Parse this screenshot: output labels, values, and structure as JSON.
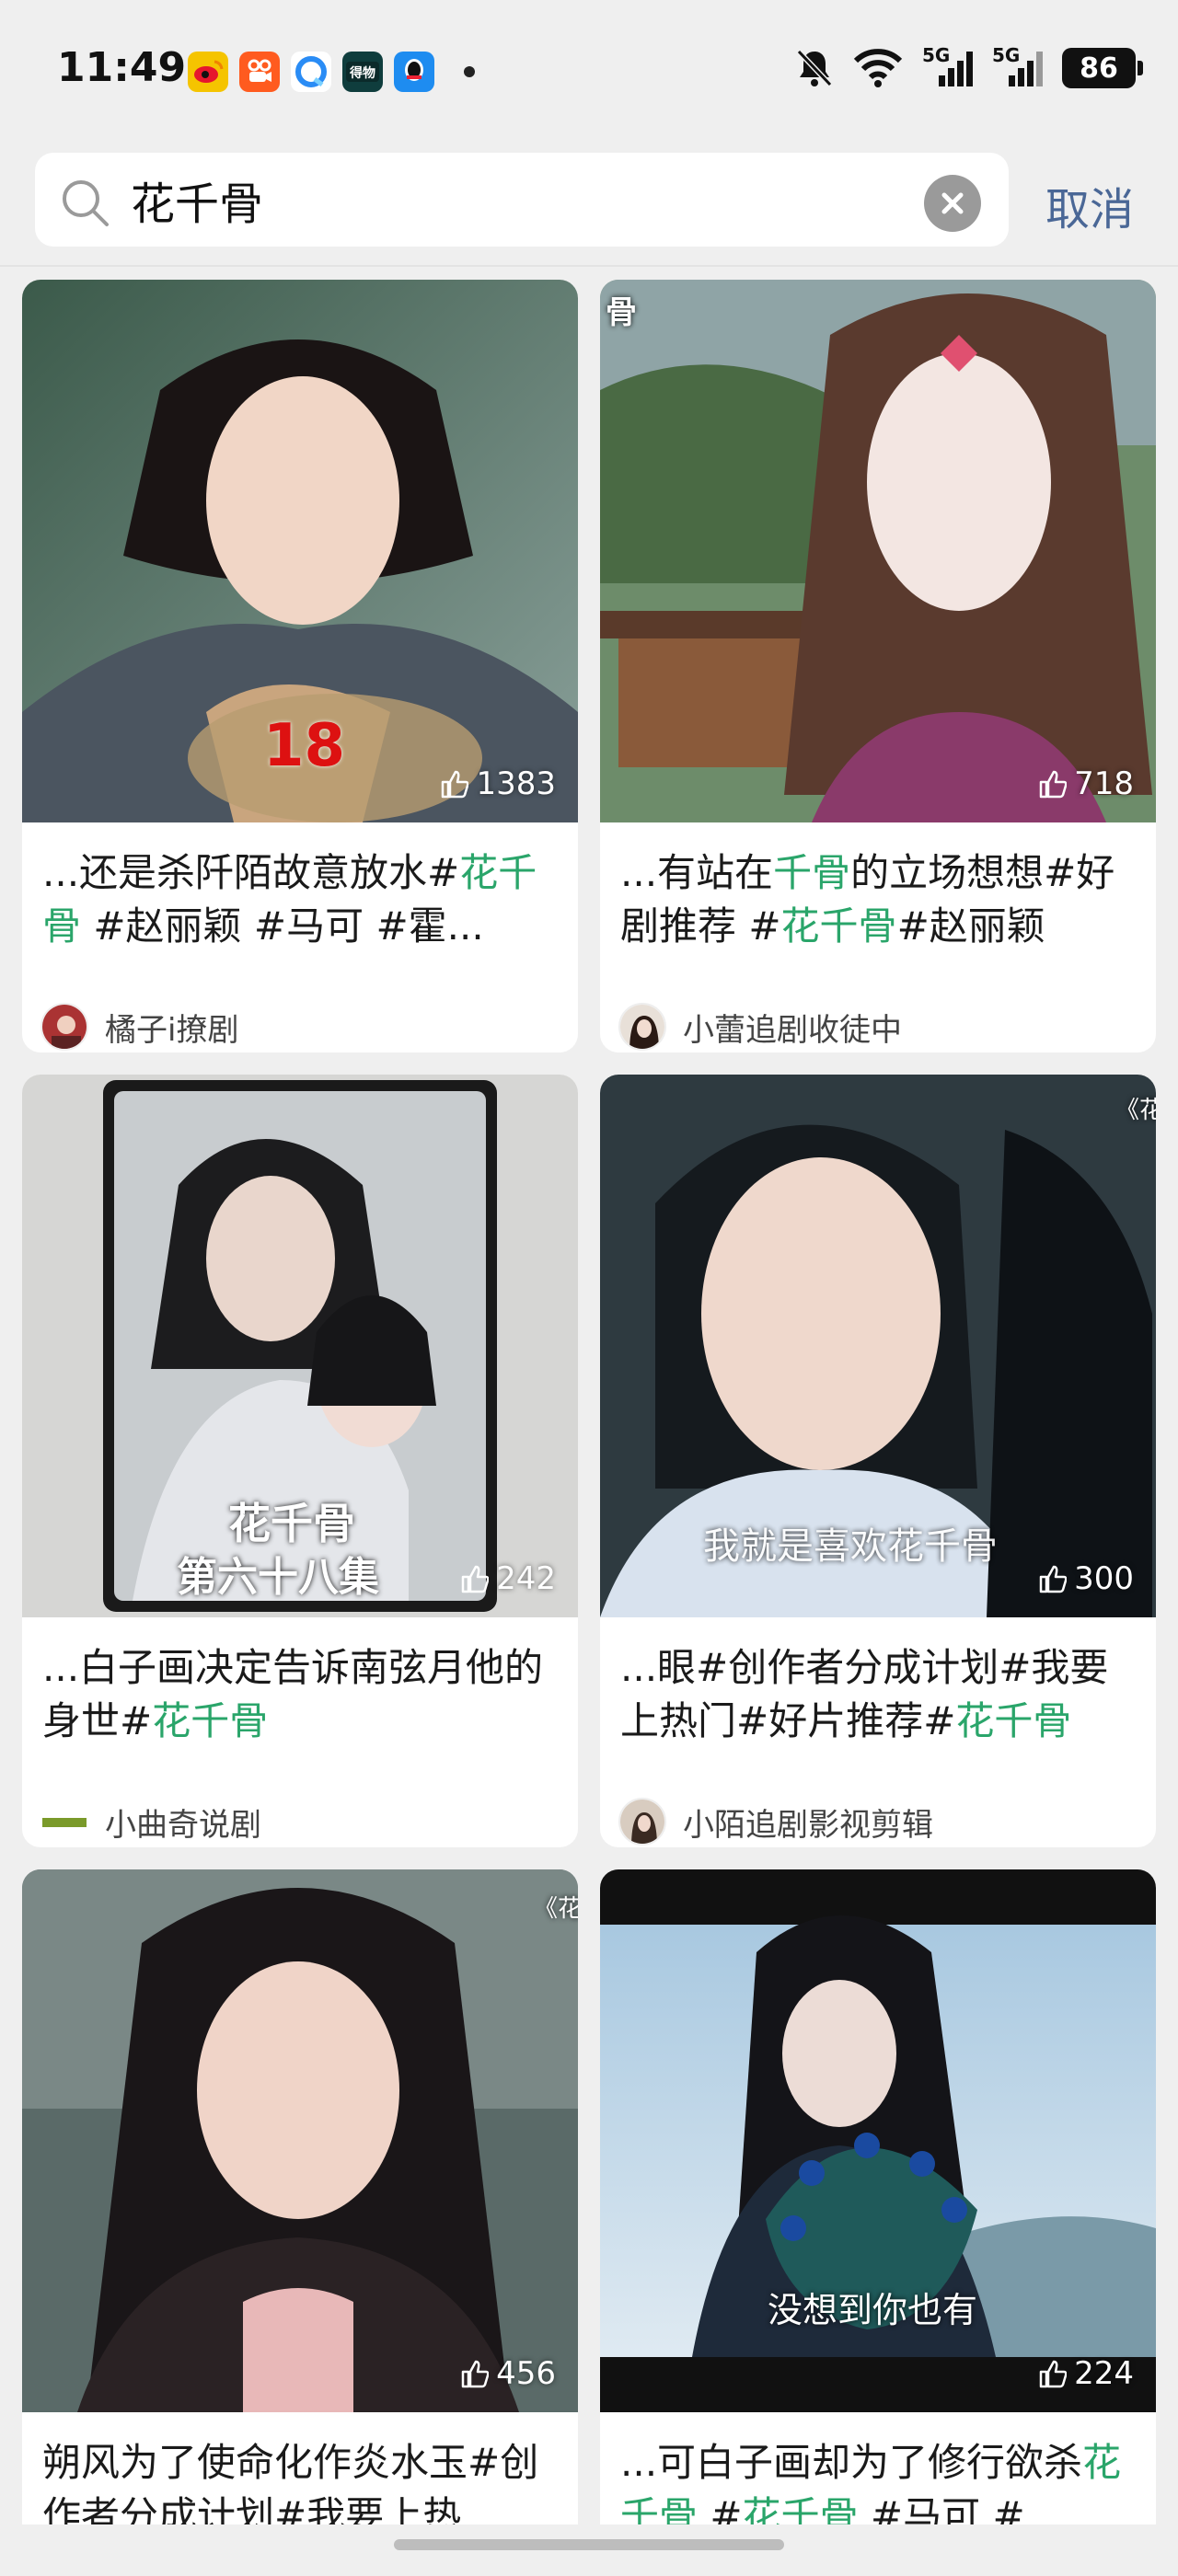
{
  "status_bar": {
    "time": "11:49",
    "battery": "86",
    "signal_1": "5G",
    "signal_2": "5G",
    "app_icons": [
      "weibo-icon",
      "kuaishou-icon",
      "browser-icon",
      "dewu-icon",
      "qq-icon"
    ],
    "system_icons": [
      "mute-icon",
      "wifi-icon",
      "signal-5g-icon",
      "signal-5g-icon",
      "battery-icon"
    ]
  },
  "search": {
    "query": "花千骨",
    "cancel_label": "取消"
  },
  "colors": {
    "highlight": "#2aa56a",
    "cancel": "#4a6796"
  },
  "cards": [
    {
      "likes": "1383",
      "caption_parts": [
        "...还是杀阡陌故意放水#",
        "花千骨",
        " #赵丽颖 #马可 #霍..."
      ],
      "author": "橘子i撩剧",
      "overlay": "18"
    },
    {
      "likes": "718",
      "caption_parts": [
        "...有站在",
        "千骨",
        "的立场想想#好剧推荐 #",
        "花千骨",
        "#赵丽颖"
      ],
      "author": "小蕾追剧收徒中",
      "overlay": "骨"
    },
    {
      "likes": "242",
      "caption_parts": [
        "...白子画决定告诉南弦月他的身世#",
        "花千骨"
      ],
      "author": "小曲奇说剧",
      "overlay": "花千骨",
      "overlay2": "第六十八集"
    },
    {
      "likes": "300",
      "caption_parts": [
        "...眼#创作者分成计划#我要上热门#好片推荐#",
        "花千骨"
      ],
      "author": "小陌追剧影视剪辑",
      "overlay": "我就是喜欢花千骨",
      "overlay2": "《花"
    },
    {
      "likes": "456",
      "caption_parts": [
        "朔风为了使命化作炎水玉#创作者分成计划#我要上热"
      ],
      "author": "",
      "overlay": "《花"
    },
    {
      "likes": "224",
      "caption_parts": [
        "...可白子画却为了修行欲杀",
        "花千骨",
        " #",
        "花千骨",
        " #马可 #"
      ],
      "author": "",
      "overlay": "没想到你也有"
    }
  ]
}
